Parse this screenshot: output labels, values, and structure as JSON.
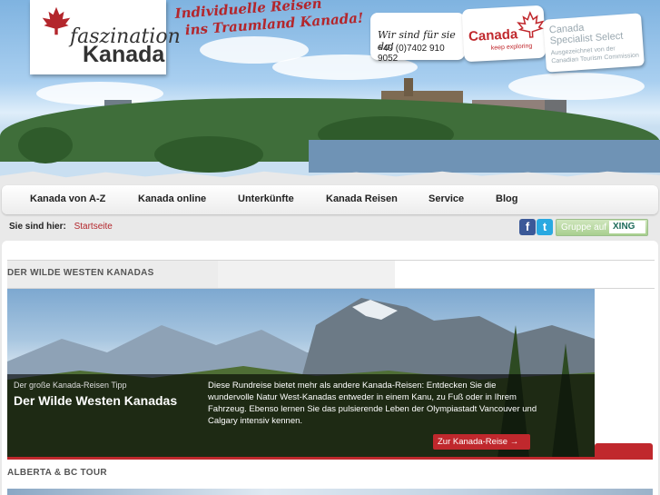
{
  "header": {
    "logo": {
      "line1": "faszination",
      "line2": "Kanada"
    },
    "slogan": {
      "line1": "Individuelle Reisen",
      "line2": "ins Traumland Kanada!"
    },
    "contact": {
      "line1": "Wir sind für sie da!",
      "phone": "+49 (0)7402 910 9052"
    },
    "canada_badge": {
      "word": "Canada",
      "tagline": "keep exploring"
    },
    "specialist": {
      "line1": "Canada",
      "line2": "Specialist Select",
      "line3": "Ausgezeichnet von der",
      "line4": "Canadian Tourism Commission"
    }
  },
  "nav": {
    "items": [
      {
        "label": "Kanada von A-Z"
      },
      {
        "label": "Kanada online"
      },
      {
        "label": "Unterkünfte"
      },
      {
        "label": "Kanada Reisen"
      },
      {
        "label": "Service"
      },
      {
        "label": "Blog"
      }
    ]
  },
  "breadcrumb": {
    "prefix": "Sie sind hier:",
    "home": "Startseite"
  },
  "social": {
    "facebook": "f",
    "twitter": "t",
    "xing_group": "Gruppe auf",
    "xing": "XING"
  },
  "sections": [
    {
      "title": "DER WILDE WESTEN KANADAS"
    },
    {
      "title": "ALBERTA & BC TOUR"
    }
  ],
  "hero": {
    "kicker": "Der große Kanada-Reisen Tipp",
    "title": "Der Wilde Westen Kanadas",
    "description": "Diese Rundreise bietet mehr als andere Kanada-Reisen: Entdecken Sie die wundervolle Natur West-Kanadas entweder in einem Kanu, zu Fuß oder in Ihrem Fahrzeug. Ebenso lernen Sie das pulsierende Leben der Olympiastadt Vancouver und Calgary intensiv kennen.",
    "cta": "Zur Kanada-Reise →"
  },
  "colors": {
    "accent": "#c0282d",
    "nav_text": "#222222",
    "section_title": "#555555"
  }
}
